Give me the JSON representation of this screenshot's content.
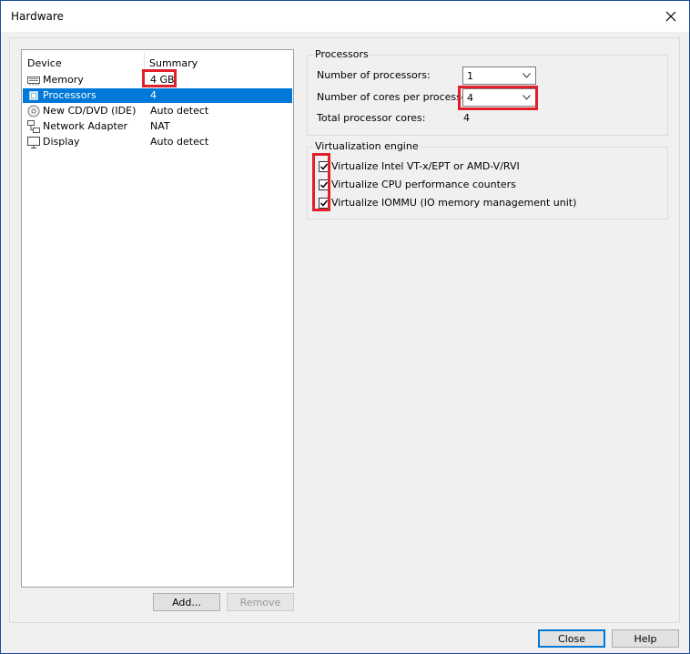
{
  "window": {
    "title": "Hardware",
    "close_icon": "close-icon"
  },
  "device_list": {
    "headers": {
      "device": "Device",
      "summary": "Summary"
    },
    "items": [
      {
        "name": "Memory",
        "summary": "4 GB",
        "icon": "memory-icon",
        "selected": false
      },
      {
        "name": "Processors",
        "summary": "4",
        "icon": "processor-icon",
        "selected": true
      },
      {
        "name": "New CD/DVD (IDE)",
        "summary": "Auto detect",
        "icon": "cd-dvd-icon",
        "selected": false
      },
      {
        "name": "Network Adapter",
        "summary": "NAT",
        "icon": "network-adapter-icon",
        "selected": false
      },
      {
        "name": "Display",
        "summary": "Auto detect",
        "icon": "display-icon",
        "selected": false
      }
    ],
    "add_label": "Add...",
    "remove_label": "Remove"
  },
  "processors": {
    "group_label": "Processors",
    "num_processors_label": "Number of processors:",
    "num_processors_value": "1",
    "cores_label": "Number of cores per processor:",
    "cores_value": "4",
    "total_label": "Total processor cores:",
    "total_value": "4"
  },
  "virtualization": {
    "group_label": "Virtualization engine",
    "options": [
      {
        "label": "Virtualize Intel VT-x/EPT or AMD-V/RVI",
        "checked": true
      },
      {
        "label": "Virtualize CPU performance counters",
        "checked": true
      },
      {
        "label": "Virtualize IOMMU (IO memory management unit)",
        "checked": true
      }
    ]
  },
  "footer": {
    "close_label": "Close",
    "help_label": "Help"
  },
  "colors": {
    "selection": "#0078d7",
    "highlight": "#e0202a",
    "window_border": "#1c4f9a"
  }
}
